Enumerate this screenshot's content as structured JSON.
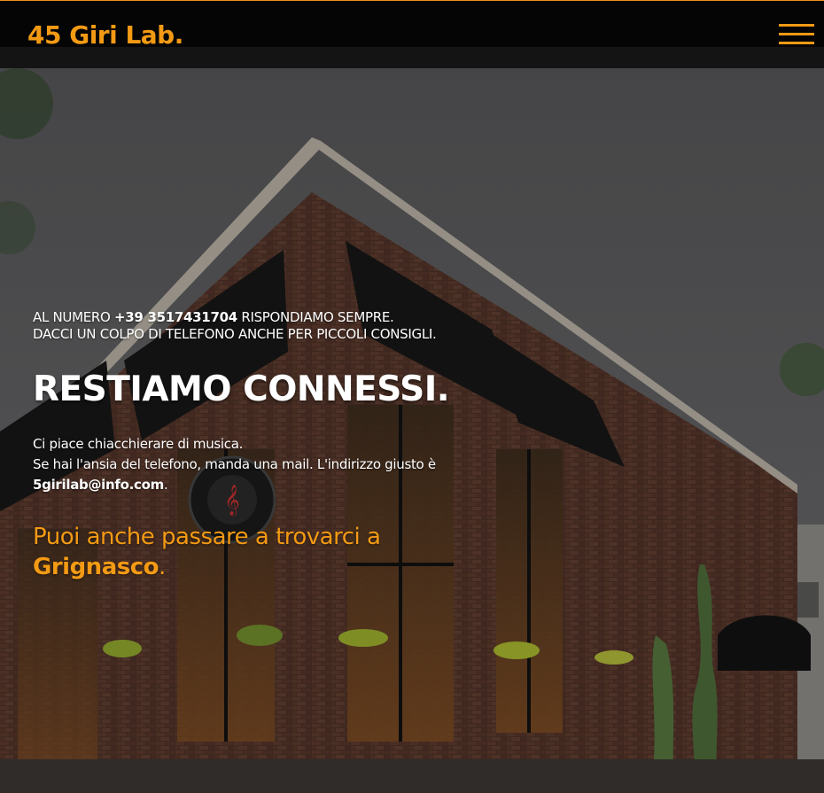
{
  "header": {
    "logo": "45 Giri Lab.",
    "menu_icon": "hamburger-menu-icon"
  },
  "hero": {
    "background_image": "brick music store building with awnings",
    "call_prefix": "AL NUMERO ",
    "phone": "+39 3517431704",
    "call_suffix": " RISPONDIAMO SEMPRE.",
    "call_line2": "DACCI UN COLPO DI TELEFONO ANCHE PER PICCOLI CONSIGLI.",
    "title": "RESTIAMO CONNESSI.",
    "body_line1": "Ci piace chiacchierare di musica.",
    "body_line2": "Se hai l'ansia del telefono, manda una mail. L'indirizzo giusto è",
    "email": "5giri​lab@info.com",
    "email_suffix": ".",
    "visit_prefix": "Puoi anche passare a trovarci a",
    "city": "Grignasco",
    "city_suffix": "."
  },
  "colors": {
    "accent": "#f39a14",
    "header_bg": "#050505",
    "text": "#ffffff"
  }
}
